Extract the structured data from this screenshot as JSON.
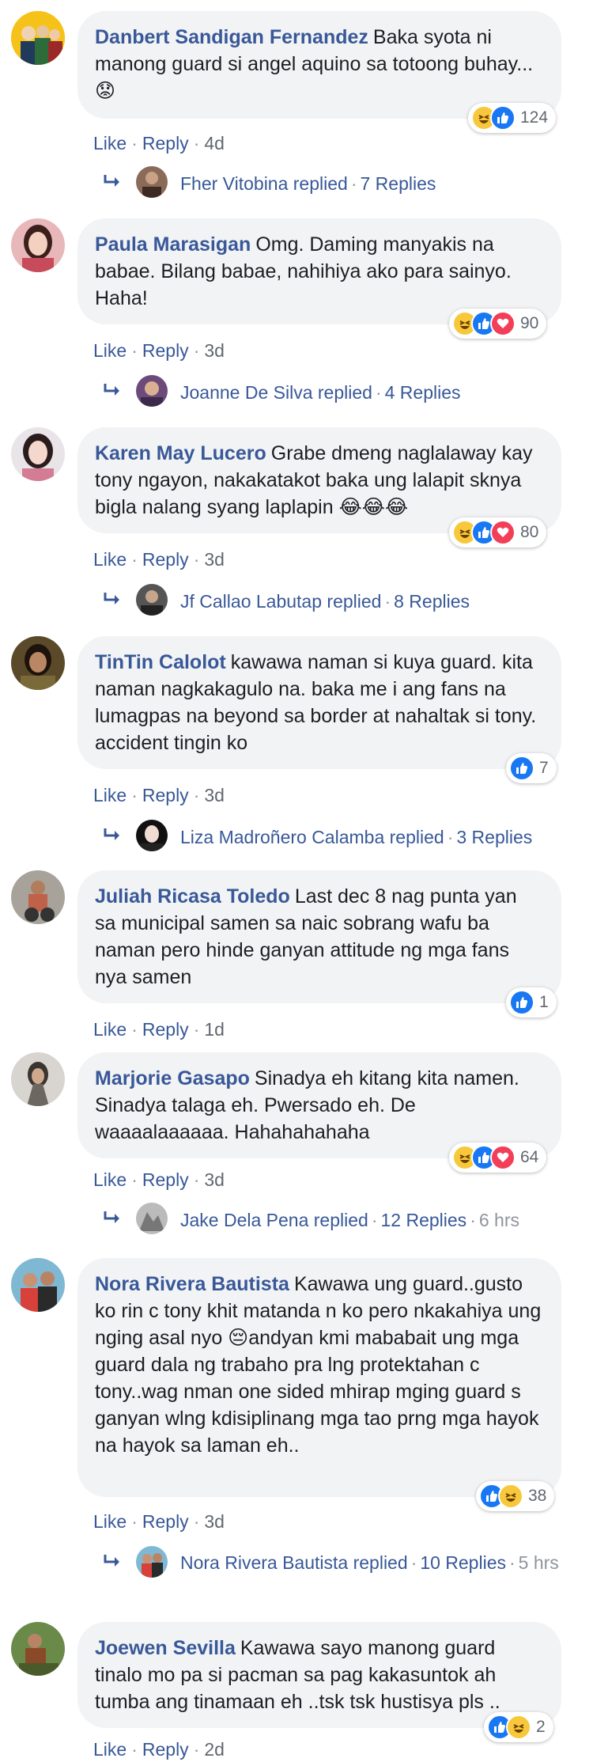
{
  "colors": {
    "link": "#385898",
    "bubble": "#f2f3f5",
    "like": "#1877f2",
    "haha": "#f7c83b",
    "love": "#f33e58",
    "meta": "#616770"
  },
  "comments": [
    {
      "author": "Danbert Sandigan Fernandez",
      "text": "Baka syota ni manong guard si angel aquino sa totoong buhay... 😟",
      "reactions": [
        "haha",
        "like"
      ],
      "reaction_count": "124",
      "like": "Like",
      "reply": "Reply",
      "time": "4d",
      "replies": {
        "name": "Fher Vitobina replied",
        "count": "7 Replies",
        "time": ""
      }
    },
    {
      "author": "Paula Marasigan",
      "text": "Omg. Daming manyakis na babae. Bilang babae, nahihiya ako para sainyo. Haha!",
      "reactions": [
        "haha",
        "like",
        "love"
      ],
      "reaction_count": "90",
      "like": "Like",
      "reply": "Reply",
      "time": "3d",
      "replies": {
        "name": "Joanne De Silva replied",
        "count": "4 Replies",
        "time": ""
      }
    },
    {
      "author": "Karen May Lucero",
      "text": "Grabe dmeng naglalaway kay tony ngayon, nakakatakot baka ung lalapit sknya bigla nalang syang laplapin 😂😂😂",
      "reactions": [
        "haha",
        "like",
        "love"
      ],
      "reaction_count": "80",
      "like": "Like",
      "reply": "Reply",
      "time": "3d",
      "replies": {
        "name": "Jf Callao Labutap replied",
        "count": "8 Replies",
        "time": ""
      }
    },
    {
      "author": "TinTin Calolot",
      "text": "kawawa naman si kuya guard. kita naman nagkakagulo na. baka me i ang fans na lumagpas na beyond sa border at nahaltak si tony. accident tingin ko",
      "reactions": [
        "like"
      ],
      "reaction_count": "7",
      "like": "Like",
      "reply": "Reply",
      "time": "3d",
      "replies": {
        "name": "Liza Madroñero Calamba replied",
        "count": "3 Replies",
        "time": ""
      }
    },
    {
      "author": "Juliah Ricasa Toledo",
      "text": "Last dec 8 nag punta yan sa municipal samen sa naic sobrang wafu ba naman pero hinde ganyan attitude ng mga fans nya samen",
      "reactions": [
        "like"
      ],
      "reaction_count": "1",
      "like": "Like",
      "reply": "Reply",
      "time": "1d",
      "replies": null
    },
    {
      "author": "Marjorie Gasapo",
      "text": "Sinadya eh kitang kita namen. Sinadya talaga eh. Pwersado eh. De waaaalaaaaaa. Hahahahahaha",
      "reactions": [
        "haha",
        "like",
        "love"
      ],
      "reaction_count": "64",
      "like": "Like",
      "reply": "Reply",
      "time": "3d",
      "replies": {
        "name": "Jake Dela Pena replied",
        "count": "12 Replies",
        "time": "6 hrs"
      }
    },
    {
      "author": "Nora Rivera Bautista",
      "text": "Kawawa ung guard..gusto ko rin c tony khit matanda n ko pero nkakahiya ung nging asal nyo 😔andyan kmi mababait ung mga guard dala ng trabaho pra lng protektahan c tony..wag nman one sided mhirap mging guard s ganyan wlng kdisiplinang mga tao prng mga hayok na hayok sa laman eh..",
      "reactions": [
        "like",
        "haha"
      ],
      "reaction_count": "38",
      "like": "Like",
      "reply": "Reply",
      "time": "3d",
      "replies": {
        "name": "Nora Rivera Bautista replied",
        "count": "10 Replies",
        "time": "5 hrs"
      }
    },
    {
      "author": "Joewen Sevilla",
      "text": "Kawawa sayo manong guard tinalo mo pa si pacman sa pag kakasuntok ah tumba ang tinamaan eh ..tsk tsk hustisya pls ..",
      "reactions": [
        "like",
        "haha"
      ],
      "reaction_count": "2",
      "like": "Like",
      "reply": "Reply",
      "time": "2d",
      "replies": null
    }
  ]
}
